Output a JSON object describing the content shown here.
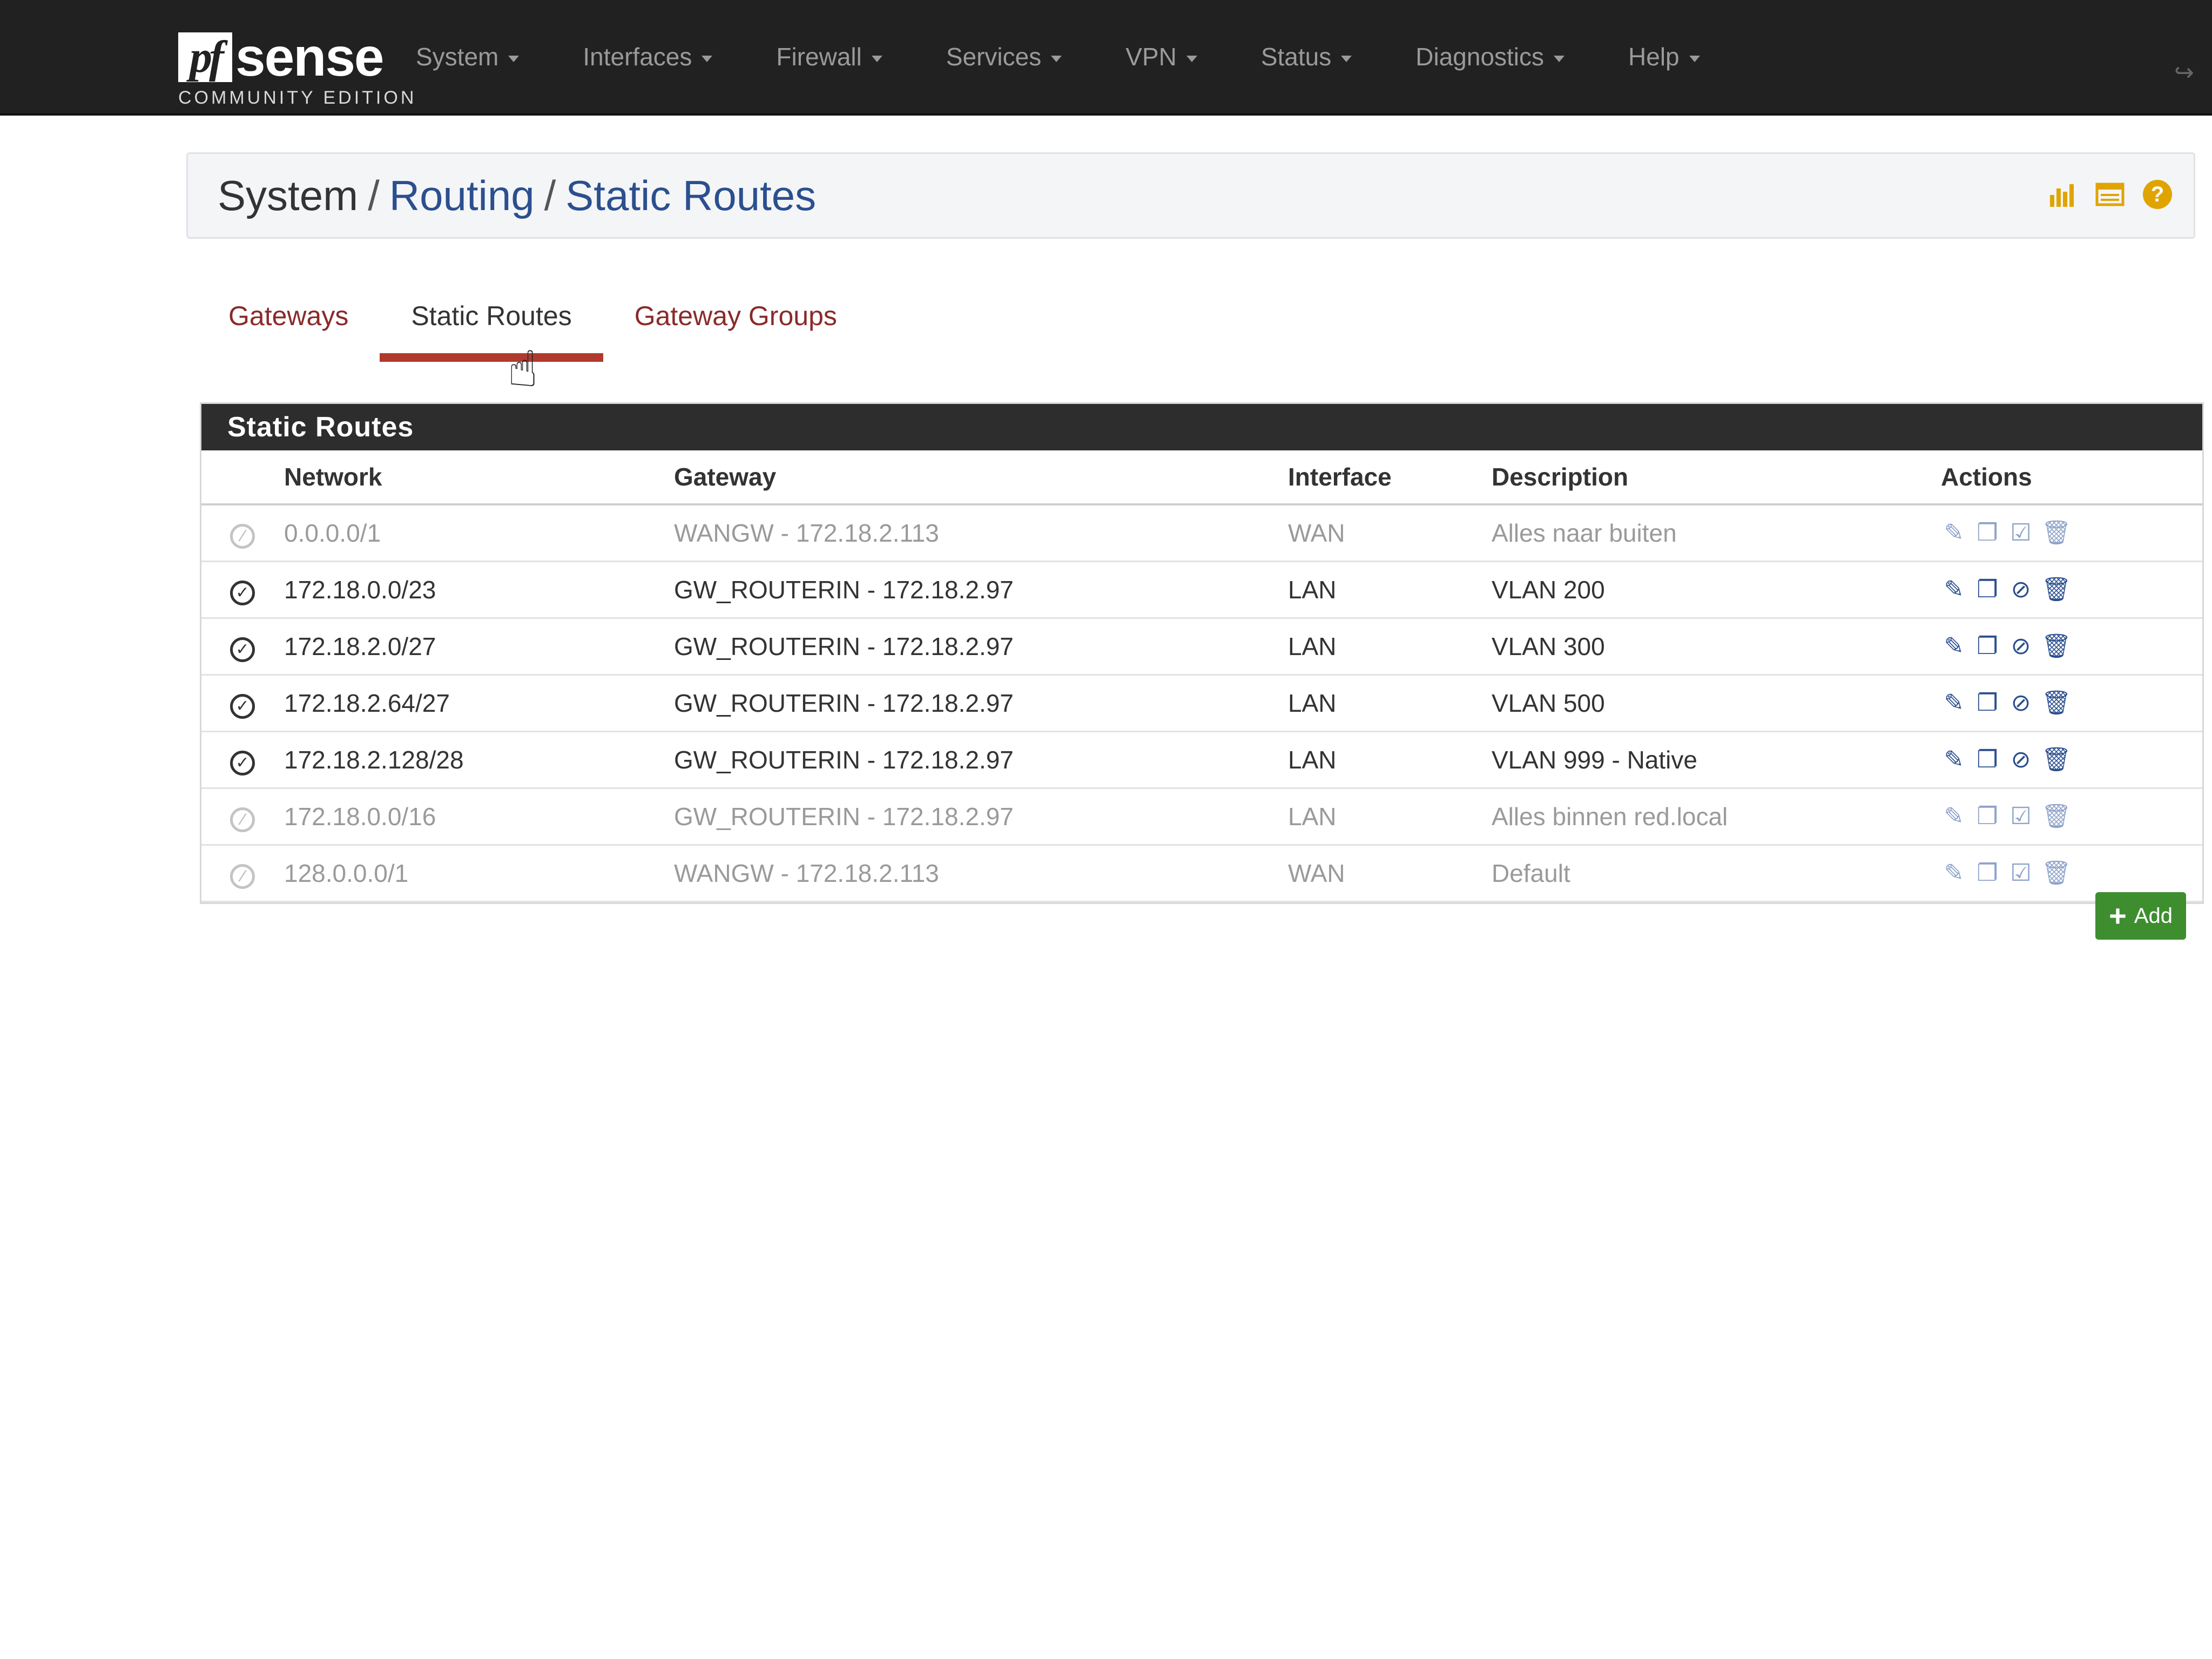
{
  "brand": {
    "logo_mark": "pf",
    "logo_word": "sense",
    "edition": "COMMUNITY EDITION"
  },
  "nav": {
    "items": [
      {
        "label": "System"
      },
      {
        "label": "Interfaces"
      },
      {
        "label": "Firewall"
      },
      {
        "label": "Services"
      },
      {
        "label": "VPN"
      },
      {
        "label": "Status"
      },
      {
        "label": "Diagnostics"
      },
      {
        "label": "Help"
      }
    ]
  },
  "breadcrumb": {
    "root": "System",
    "section": "Routing",
    "page": "Static Routes",
    "separator": "/"
  },
  "header_icons": [
    "chart-icon",
    "list-icon",
    "help-icon"
  ],
  "tabs": [
    {
      "label": "Gateways",
      "active": false
    },
    {
      "label": "Static Routes",
      "active": true
    },
    {
      "label": "Gateway Groups",
      "active": false
    }
  ],
  "panel": {
    "title": "Static Routes",
    "columns": {
      "network": "Network",
      "gateway": "Gateway",
      "interface": "Interface",
      "description": "Description",
      "actions": "Actions"
    },
    "rows": [
      {
        "enabled": false,
        "network": "0.0.0.0/1",
        "gateway": "WANGW - 172.18.2.113",
        "interface": "WAN",
        "description": "Alles naar buiten"
      },
      {
        "enabled": true,
        "network": "172.18.0.0/23",
        "gateway": "GW_ROUTERIN - 172.18.2.97",
        "interface": "LAN",
        "description": "VLAN 200"
      },
      {
        "enabled": true,
        "network": "172.18.2.0/27",
        "gateway": "GW_ROUTERIN - 172.18.2.97",
        "interface": "LAN",
        "description": "VLAN 300"
      },
      {
        "enabled": true,
        "network": "172.18.2.64/27",
        "gateway": "GW_ROUTERIN - 172.18.2.97",
        "interface": "LAN",
        "description": "VLAN 500"
      },
      {
        "enabled": true,
        "network": "172.18.2.128/28",
        "gateway": "GW_ROUTERIN - 172.18.2.97",
        "interface": "LAN",
        "description": "VLAN 999 - Native"
      },
      {
        "enabled": false,
        "network": "172.18.0.0/16",
        "gateway": "GW_ROUTERIN - 172.18.2.97",
        "interface": "LAN",
        "description": "Alles binnen red.local"
      },
      {
        "enabled": false,
        "network": "128.0.0.0/1",
        "gateway": "WANGW - 172.18.2.113",
        "interface": "WAN",
        "description": "Default"
      }
    ]
  },
  "add_button": {
    "label": "Add"
  },
  "colors": {
    "navbar": "#212121",
    "link": "#2b4f8f",
    "tab_accent": "#b03a2e",
    "panel_heading": "#2d2d2d",
    "add_button": "#3e8e30",
    "header_icon": "#e0a400"
  }
}
